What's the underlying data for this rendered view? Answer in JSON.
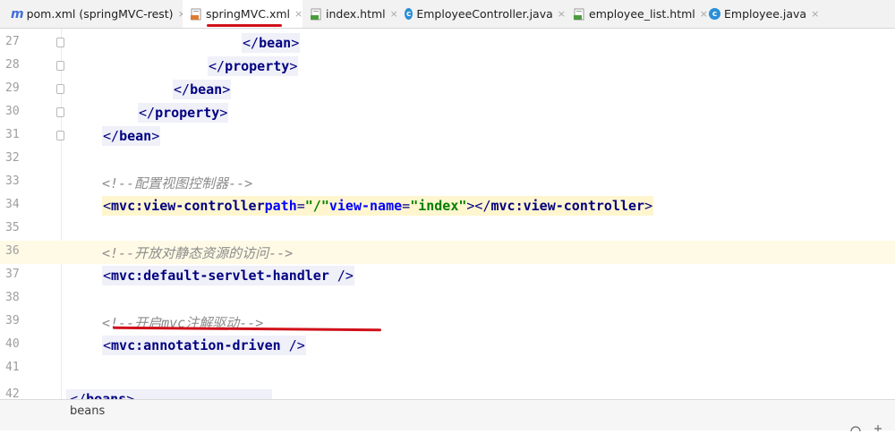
{
  "tabs": [
    {
      "label": "pom.xml (springMVC-rest)",
      "icon": "maven-m-icon",
      "active": false
    },
    {
      "label": "springMVC.xml",
      "icon": "xml-file-icon",
      "active": true
    },
    {
      "label": "index.html",
      "icon": "html-file-icon",
      "active": false
    },
    {
      "label": "EmployeeController.java",
      "icon": "java-class-icon",
      "active": false
    },
    {
      "label": "employee_list.html",
      "icon": "html-file-icon",
      "active": false
    },
    {
      "label": "Employee.java",
      "icon": "java-class-icon",
      "active": false
    }
  ],
  "close_glyph": "×",
  "lines": [
    {
      "num": "27",
      "close": "</",
      "name": "bean",
      "end": ">"
    },
    {
      "num": "28",
      "close": "</",
      "name": "property",
      "end": ">"
    },
    {
      "num": "29",
      "close": "</",
      "name": "bean",
      "end": ">"
    },
    {
      "num": "30",
      "close": "</",
      "name": "property",
      "end": ">"
    },
    {
      "num": "31",
      "close": "</",
      "name": "bean",
      "end": ">"
    },
    {
      "num": "32"
    },
    {
      "num": "33",
      "comment": "<!--配置视图控制器-->"
    },
    {
      "num": "34",
      "open": "<",
      "name": "mvc:view-controller",
      "attr1": "path",
      "eq": "=",
      "val1": "\"/\"",
      "attr2": "view-name",
      "val2": "\"index\"",
      "mid": "></",
      "name2": "mvc:view-controller",
      "end": ">"
    },
    {
      "num": "35"
    },
    {
      "num": "36",
      "comment": "<!--开放对静态资源的访问-->"
    },
    {
      "num": "37",
      "open": "<",
      "name": "mvc:default-servlet-handler",
      "end": " />"
    },
    {
      "num": "38"
    },
    {
      "num": "39",
      "comment": "<!--开启mvc注解驱动-->"
    },
    {
      "num": "40",
      "open": "<",
      "name": "mvc:annotation-driven",
      "end": " />"
    },
    {
      "num": "41"
    },
    {
      "num": "42",
      "close": "</",
      "name": "beans",
      "end": ">"
    }
  ],
  "breadcrumb": "beans",
  "colors": {
    "annotation_underline": "#d0101a",
    "caret_line": "#fffae5",
    "tag": "#000080",
    "attr_name": "#0000ff",
    "attr_value": "#008000",
    "comment": "#8c8c8c"
  }
}
